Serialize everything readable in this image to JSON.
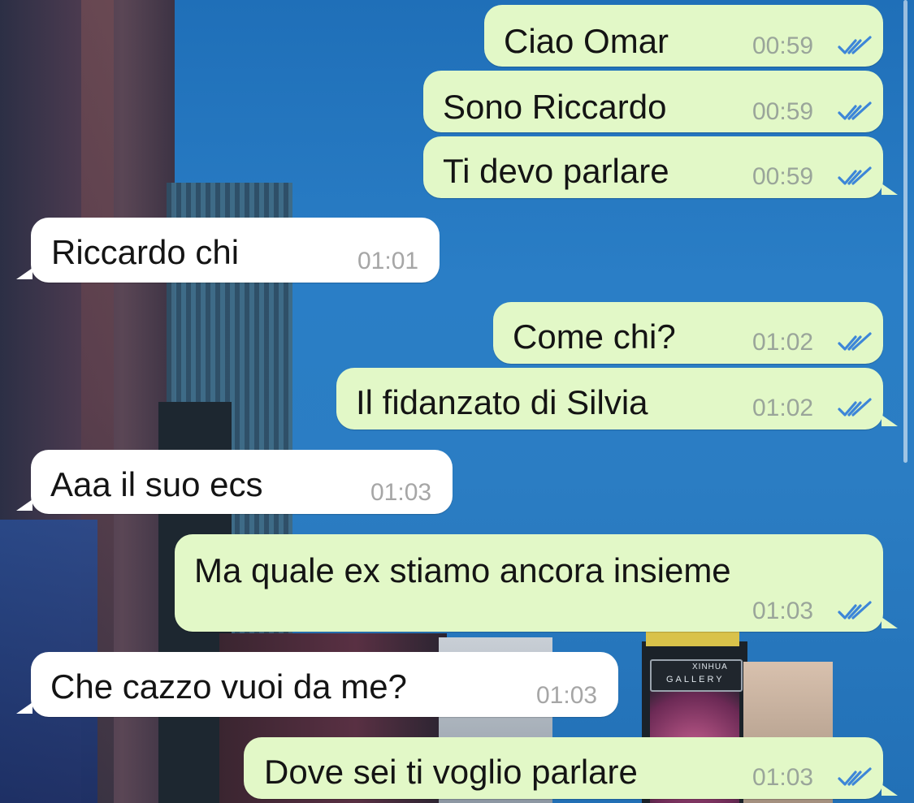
{
  "chat": {
    "colors": {
      "outgoing_bubble": "#e2f8c7",
      "incoming_bubble": "#ffffff",
      "read_ticks": "#3d86d8",
      "timestamp": "#9aa59a"
    },
    "messages": [
      {
        "direction": "outgoing",
        "text": "Ciao Omar",
        "time": "00:59",
        "status": "read"
      },
      {
        "direction": "outgoing",
        "text": "Sono Riccardo",
        "time": "00:59",
        "status": "read"
      },
      {
        "direction": "outgoing",
        "text": "Ti devo parlare",
        "time": "00:59",
        "status": "read"
      },
      {
        "direction": "incoming",
        "text": "Riccardo chi",
        "time": "01:01"
      },
      {
        "direction": "outgoing",
        "text": "Come chi?",
        "time": "01:02",
        "status": "read"
      },
      {
        "direction": "outgoing",
        "text": "Il fidanzato di Silvia",
        "time": "01:02",
        "status": "read"
      },
      {
        "direction": "incoming",
        "text": "Aaa il suo ecs",
        "time": "01:03"
      },
      {
        "direction": "outgoing",
        "text": "Ma quale ex stiamo ancora insieme",
        "time": "01:03",
        "status": "read"
      },
      {
        "direction": "incoming",
        "text": "Che cazzo vuoi da me?",
        "time": "01:03"
      },
      {
        "direction": "outgoing",
        "text": "Dove sei ti voglio parlare",
        "time": "01:03",
        "status": "read"
      }
    ]
  },
  "wallpaper": {
    "signs": [
      "XINHUA",
      "GALLERY"
    ]
  }
}
